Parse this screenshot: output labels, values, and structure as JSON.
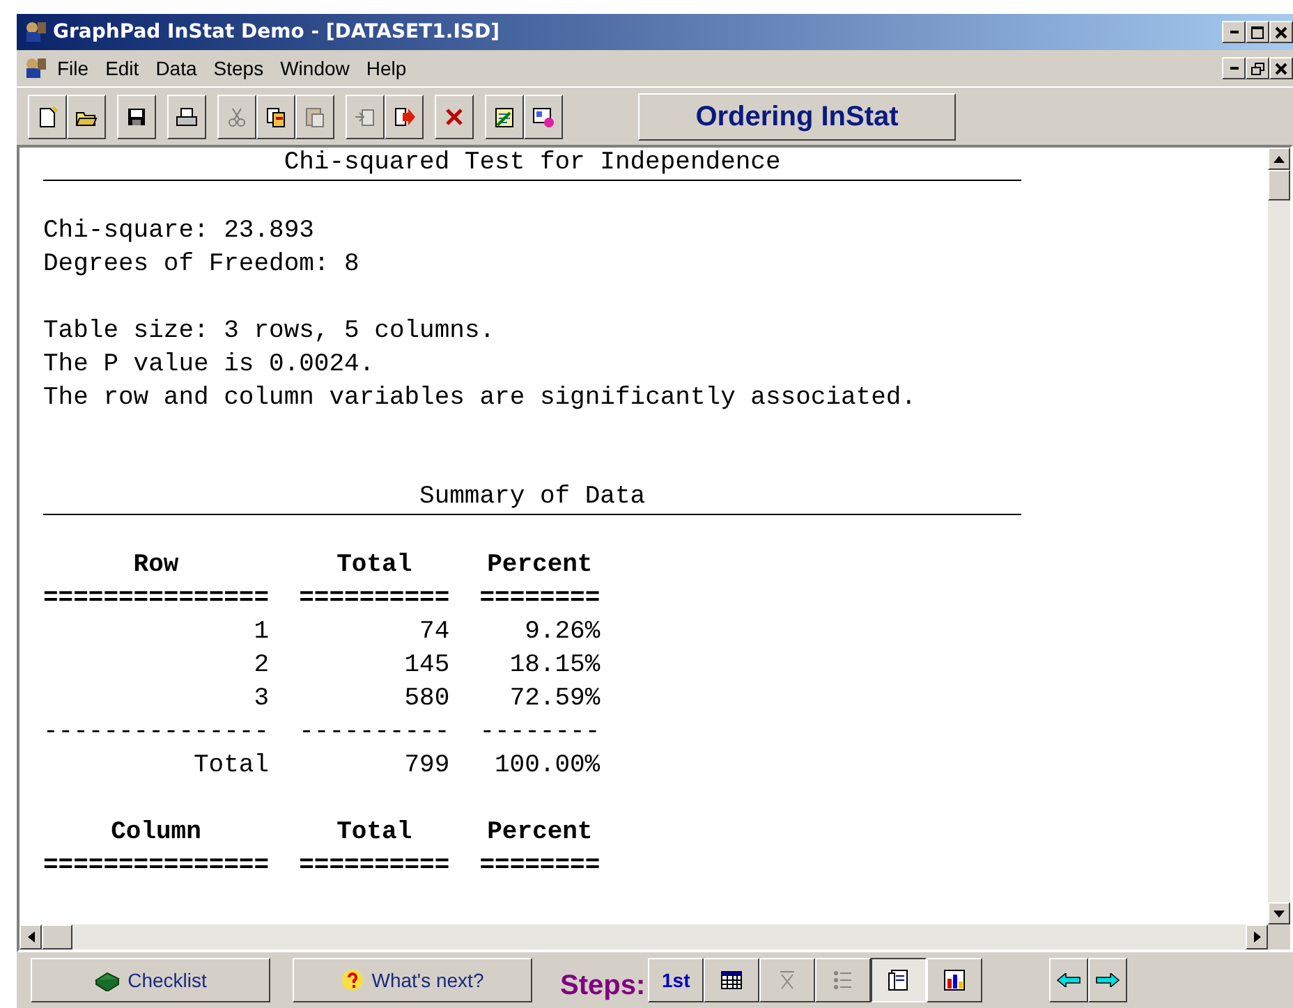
{
  "window": {
    "title": "GraphPad InStat Demo - [DATASET1.ISD]"
  },
  "menu": [
    "File",
    "Edit",
    "Data",
    "Steps",
    "Window",
    "Help"
  ],
  "toolbar": {
    "groups": [
      [
        {
          "kind": "new",
          "disabled": false
        },
        {
          "kind": "open",
          "disabled": false
        }
      ],
      [
        {
          "kind": "save",
          "disabled": false
        }
      ],
      [
        {
          "kind": "print",
          "disabled": false
        }
      ],
      [
        {
          "kind": "cut",
          "disabled": true
        },
        {
          "kind": "copy",
          "disabled": false
        },
        {
          "kind": "paste",
          "disabled": true
        }
      ],
      [
        {
          "kind": "import",
          "disabled": true
        },
        {
          "kind": "export",
          "disabled": false
        }
      ],
      [
        {
          "kind": "delete",
          "disabled": false
        }
      ],
      [
        {
          "kind": "notes",
          "disabled": false
        },
        {
          "kind": "presentation",
          "disabled": false
        }
      ]
    ],
    "ordering_button": "Ordering InStat"
  },
  "report": {
    "heading": "Chi-squared Test for Independence",
    "blocks": [
      [
        "Chi-square: 23.893",
        "Degrees of Freedom: 8"
      ],
      [
        "Table size: 3 rows, 5 columns.",
        "The P value is 0.0024.",
        "The row and column variables are significantly associated."
      ]
    ]
  },
  "summary": {
    "heading": "Summary of Data",
    "tables": [
      {
        "columns": [
          "Row",
          "Total",
          "Percent"
        ],
        "rule": [
          "===============",
          "==========",
          "========"
        ],
        "rows": [
          [
            "1",
            "74",
            "9.26%"
          ],
          [
            "2",
            "145",
            "18.15%"
          ],
          [
            "3",
            "580",
            "72.59%"
          ]
        ],
        "divider": [
          "---------------",
          "----------",
          "--------"
        ],
        "total": [
          "Total",
          "799",
          "100.00%"
        ]
      },
      {
        "columns": [
          "Column",
          "Total",
          "Percent"
        ],
        "rule": [
          "===============",
          "==========",
          "========"
        ]
      }
    ]
  },
  "bottom_bar": {
    "checklist": "Checklist",
    "whats_next": "What's next?",
    "steps_label": "Steps:",
    "steps": [
      {
        "kind": "first",
        "label": "1st",
        "selected": false,
        "disabled": false
      },
      {
        "kind": "table",
        "selected": false,
        "disabled": false
      },
      {
        "kind": "sigma",
        "selected": false,
        "disabled": true
      },
      {
        "kind": "list",
        "selected": false,
        "disabled": true
      },
      {
        "kind": "results",
        "selected": true,
        "disabled": false
      },
      {
        "kind": "graph",
        "selected": false,
        "disabled": false
      }
    ]
  }
}
